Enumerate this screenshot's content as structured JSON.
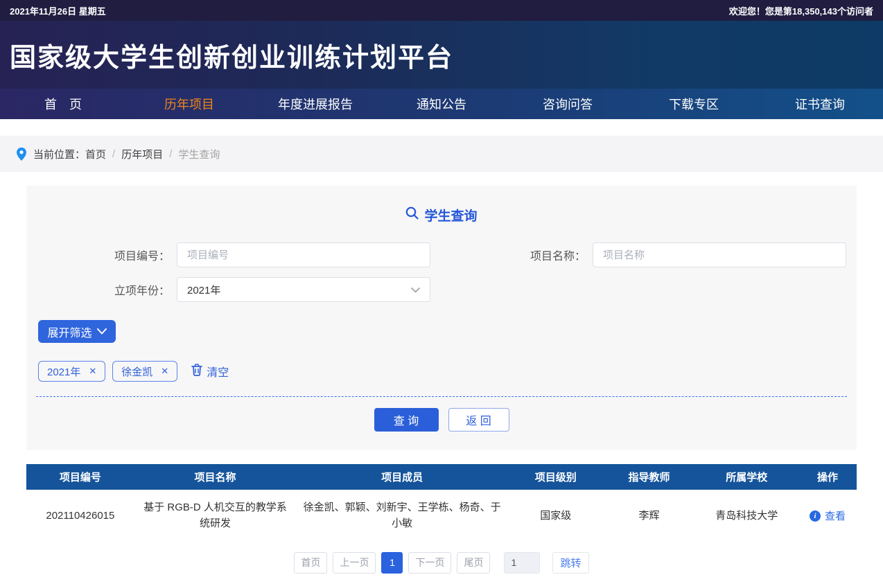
{
  "topbar": {
    "date": "2021年11月26日 星期五",
    "welcome": "欢迎您！您是第18,350,143个访问者"
  },
  "header": {
    "title": "国家级大学生创新创业训练计划平台"
  },
  "nav": {
    "items": [
      {
        "label": "首　页",
        "active": false
      },
      {
        "label": "历年项目",
        "active": true
      },
      {
        "label": "年度进展报告",
        "active": false
      },
      {
        "label": "通知公告",
        "active": false
      },
      {
        "label": "咨询问答",
        "active": false
      },
      {
        "label": "下载专区",
        "active": false
      },
      {
        "label": "证书查询",
        "active": false
      }
    ]
  },
  "breadcrumb": {
    "prefix": "当前位置：",
    "separator": "/",
    "items": [
      "首页",
      "历年项目",
      "学生查询"
    ]
  },
  "search": {
    "title": "学生查询",
    "fields": {
      "project_code": {
        "label": "项目编号：",
        "placeholder": "项目编号"
      },
      "project_name": {
        "label": "项目名称：",
        "placeholder": "项目名称"
      },
      "year": {
        "label": "立项年份：",
        "value": "2021年"
      }
    },
    "expand_button": "展开筛选",
    "tags": [
      "2021年",
      "徐金凯"
    ],
    "clear_label": "清空",
    "query_button": "查 询",
    "back_button": "返 回"
  },
  "icons": {
    "close": "✕",
    "info": "i"
  },
  "table": {
    "headers": [
      "项目编号",
      "项目名称",
      "项目成员",
      "项目级别",
      "指导教师",
      "所属学校",
      "操作"
    ],
    "rows": [
      {
        "code": "202110426015",
        "name": "基于 RGB-D 人机交互的教学系统研发",
        "members": "徐金凯、郭颖、刘新宇、王学栋、杨奇、于小敏",
        "level": "国家级",
        "teacher": "李辉",
        "school": "青岛科技大学",
        "action": "查看"
      }
    ]
  },
  "pagination": {
    "first": "首页",
    "prev": "上一页",
    "current": "1",
    "next": "下一页",
    "last": "尾页",
    "input_value": "1",
    "jump": "跳转"
  },
  "colors": {
    "accent_blue": "#2b5fd9",
    "active_orange": "#f08519",
    "table_header_blue": "#15549b",
    "topbar_dark": "#201d41"
  }
}
